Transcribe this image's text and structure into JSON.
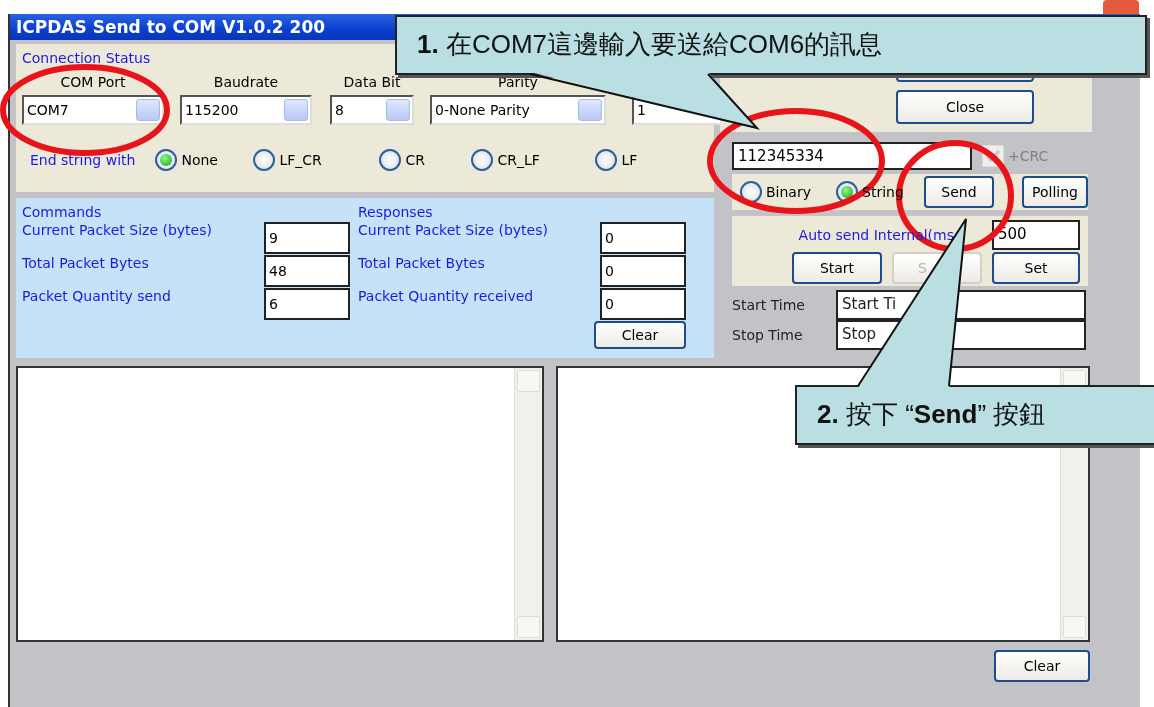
{
  "window": {
    "title": "ICPDAS Send to COM V1.0.2  200"
  },
  "connection": {
    "heading": "Connection Status",
    "fields": [
      {
        "label": "COM Port",
        "value": "COM7"
      },
      {
        "label": "Baudrate",
        "value": "115200"
      },
      {
        "label": "Data Bit",
        "value": "8"
      },
      {
        "label": "Parity",
        "value": "0-None Parity"
      },
      {
        "value": "1"
      }
    ]
  },
  "close_button": "Close",
  "end_string": {
    "label": "End string with",
    "options": [
      {
        "label": "None",
        "selected": true
      },
      {
        "label": "LF_CR",
        "selected": false
      },
      {
        "label": "CR",
        "selected": false
      },
      {
        "label": "CR_LF",
        "selected": false
      },
      {
        "label": "LF",
        "selected": false
      }
    ]
  },
  "message": {
    "value": "112345334",
    "crc": {
      "label": "+CRC",
      "checked": true,
      "disabled": true
    }
  },
  "format_options": [
    {
      "label": "Binary",
      "selected": false
    },
    {
      "label": "String",
      "selected": true
    }
  ],
  "send_button": "Send",
  "polling_button": "Polling",
  "auto_send": {
    "label": "Auto send Internal(ms",
    "value": "500",
    "buttons": [
      {
        "label": "Start",
        "disabled": false
      },
      {
        "label": "S",
        "disabled": true
      },
      {
        "label": "Set",
        "disabled": false
      }
    ]
  },
  "times": [
    {
      "label": "Start Time",
      "value": "Start Ti"
    },
    {
      "label": "Stop Time",
      "value": "Stop"
    }
  ],
  "stats": [
    {
      "heading": "Commands",
      "rows": [
        {
          "label": "Current Packet Size (bytes)",
          "value": "9"
        },
        {
          "label": "Total Packet Bytes",
          "value": "48"
        },
        {
          "label": "Packet Quantity send",
          "value": "6"
        }
      ]
    },
    {
      "heading": "Responses",
      "rows": [
        {
          "label": "Current Packet Size (bytes)",
          "value": "0"
        },
        {
          "label": "Total Packet Bytes",
          "value": "0"
        },
        {
          "label": "Packet Quantity received",
          "value": "0"
        }
      ]
    }
  ],
  "stats_clear_button": "Clear",
  "log_clear_button": "Clear",
  "callouts": [
    {
      "text": "**1.** 在COM7這邊輸入要送給COM6的訊息"
    },
    {
      "text": "**2.** 按下 “**Send**” 按鈕"
    }
  ]
}
